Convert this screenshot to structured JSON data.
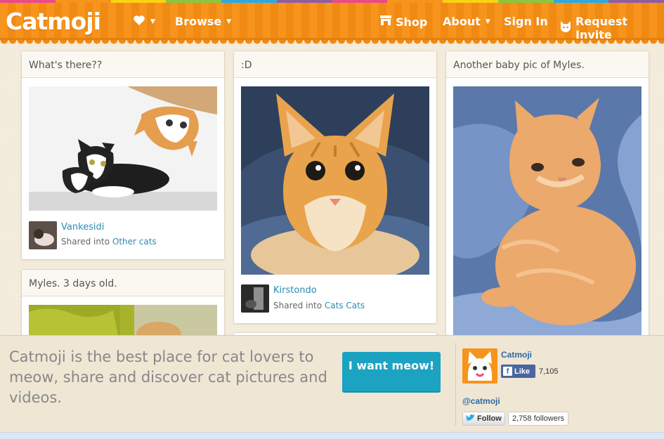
{
  "header": {
    "logo": "Catmoji",
    "nav": {
      "browse": "Browse",
      "shop": "Shop",
      "about": "About",
      "sign_in": "Sign In",
      "request_invite": "Request Invite"
    }
  },
  "colors": {
    "brand_orange": "#f7941d",
    "link_blue": "#2b8bb5",
    "cta_teal": "#1ba3c1",
    "facebook_blue": "#4a66a0"
  },
  "icons": [
    "heart-icon",
    "chevron-down-icon",
    "shop-icon",
    "cat-shield-icon",
    "facebook-icon",
    "twitter-bird-icon"
  ],
  "posts": [
    {
      "title": "What's there??",
      "user": "Vankesidi",
      "shared_prefix": "Shared into",
      "collection": "Other cats"
    },
    {
      "title": ":D",
      "user": "Kirstondo",
      "shared_prefix": "Shared into",
      "collection": "Cats Cats"
    },
    {
      "title": "Another baby pic of Myles."
    },
    {
      "title": "Myles. 3 days old."
    }
  ],
  "banner": {
    "text": "Catmoji is the best place for cat lovers to meow, share and discover cat pictures and videos.",
    "cta": "I want meow!",
    "facebook": {
      "name": "Catmoji",
      "like_label": "Like",
      "like_count": "7,105"
    },
    "twitter": {
      "handle": "@catmoji",
      "follow_label": "Follow",
      "followers": "2,758 followers"
    }
  }
}
